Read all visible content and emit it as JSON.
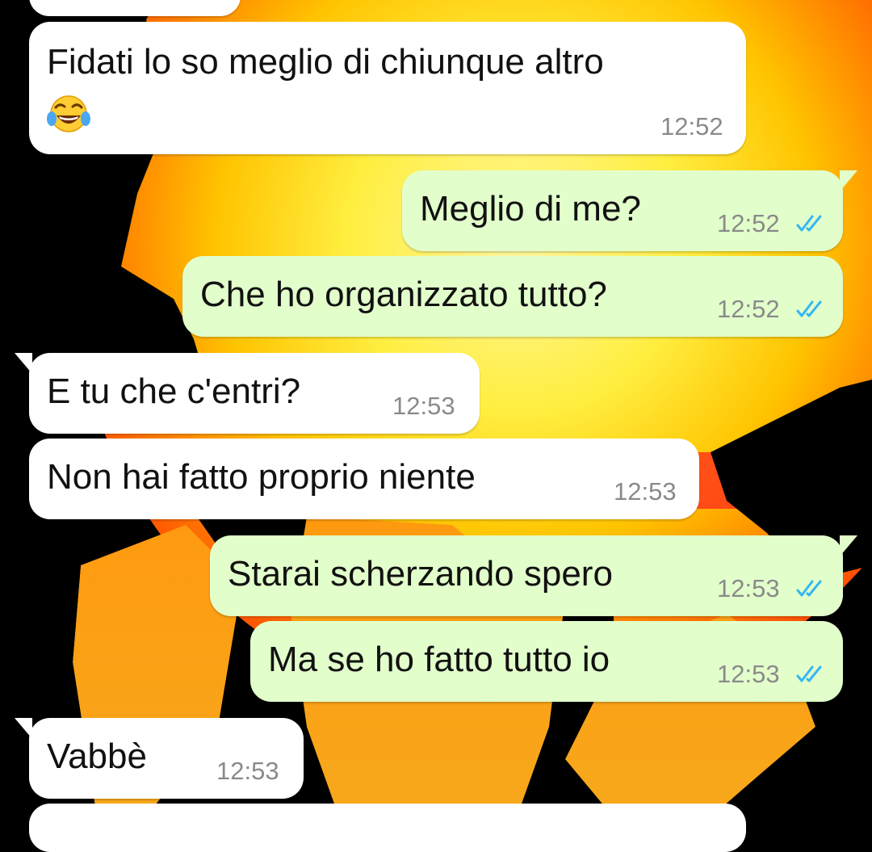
{
  "colors": {
    "incoming_bubble": "#ffffff",
    "outgoing_bubble": "#e2fecb",
    "read_ticks": "#34b7f1",
    "timestamp": "#8a8a8a"
  },
  "messages": [
    {
      "direction": "incoming",
      "text": "",
      "time": ""
    },
    {
      "direction": "incoming",
      "text": "Fidati lo so meglio di chiunque altro",
      "emoji": "face-with-tears-of-joy-icon",
      "time": "12:52"
    },
    {
      "direction": "outgoing",
      "text": "Meglio di me?",
      "time": "12:52",
      "status": "read"
    },
    {
      "direction": "outgoing",
      "text": "Che ho organizzato tutto?",
      "time": "12:52",
      "status": "read"
    },
    {
      "direction": "incoming",
      "text": "E tu che c'entri?",
      "time": "12:53"
    },
    {
      "direction": "incoming",
      "text": "Non hai fatto proprio niente",
      "time": "12:53"
    },
    {
      "direction": "outgoing",
      "text": "Starai scherzando spero",
      "time": "12:53",
      "status": "read"
    },
    {
      "direction": "outgoing",
      "text": "Ma se ho fatto tutto io",
      "time": "12:53",
      "status": "read"
    },
    {
      "direction": "incoming",
      "text": "Vabbè",
      "time": "12:53"
    },
    {
      "direction": "incoming",
      "text": "",
      "time": ""
    }
  ]
}
